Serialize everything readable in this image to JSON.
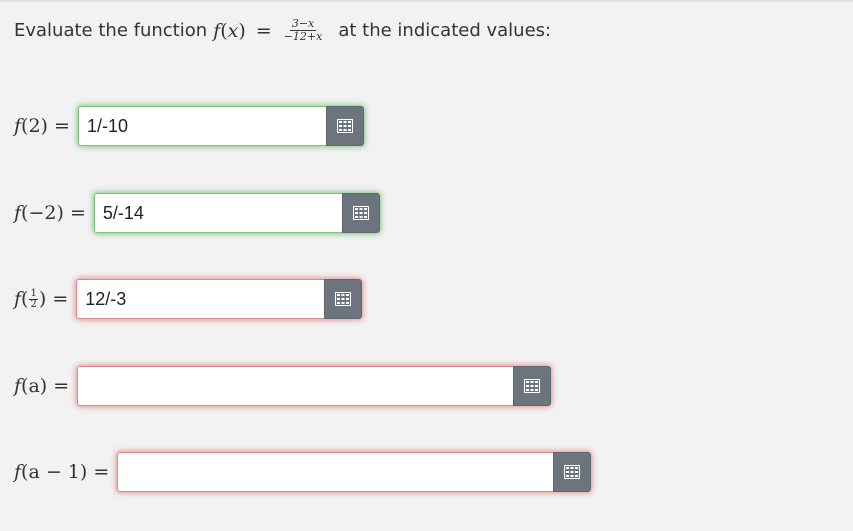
{
  "question": {
    "prefix": "Evaluate the function",
    "fname": "f",
    "var": "x",
    "lparen": "(",
    "rparen": ")",
    "equals": "=",
    "numerator": "3−x",
    "denominator": "−12+x",
    "suffix": "at the indicated values:"
  },
  "rows": [
    {
      "label_pre": "f",
      "label_arg": "(2)",
      "label_eq": "=",
      "value": "1/-10",
      "status": "correct"
    },
    {
      "label_pre": "f",
      "label_arg": "(−2)",
      "label_eq": "=",
      "value": "5/-14",
      "status": "correct"
    },
    {
      "label_pre": "f",
      "label_open": "(",
      "frac_num": "1",
      "frac_den": "2",
      "label_close": ")",
      "label_eq": "=",
      "value": "12/-3",
      "status": "incorrect"
    },
    {
      "label_pre": "f",
      "label_arg": "(a)",
      "label_eq": "=",
      "value": "",
      "status": "incorrect"
    },
    {
      "label_pre": "f",
      "label_arg": "(a − 1)",
      "label_eq": "=",
      "value": "",
      "status": "incorrect"
    }
  ],
  "icons": {
    "keyboard_button": "keypad-icon"
  }
}
